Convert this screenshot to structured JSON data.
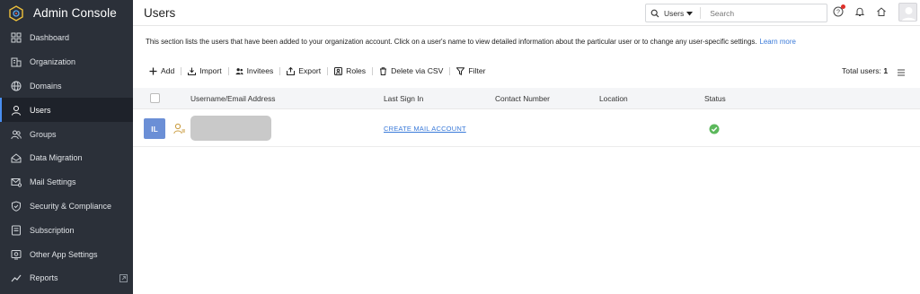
{
  "sidebar": {
    "title": "Admin Console",
    "items": [
      {
        "label": "Dashboard",
        "icon": "dashboard-icon"
      },
      {
        "label": "Organization",
        "icon": "organization-icon"
      },
      {
        "label": "Domains",
        "icon": "globe-icon"
      },
      {
        "label": "Users",
        "icon": "user-icon",
        "active": true
      },
      {
        "label": "Groups",
        "icon": "groups-icon"
      },
      {
        "label": "Data Migration",
        "icon": "migration-icon"
      },
      {
        "label": "Mail Settings",
        "icon": "mail-settings-icon"
      },
      {
        "label": "Security & Compliance",
        "icon": "shield-icon"
      },
      {
        "label": "Subscription",
        "icon": "subscription-icon"
      },
      {
        "label": "Other App Settings",
        "icon": "app-settings-icon"
      },
      {
        "label": "Reports",
        "icon": "reports-icon"
      }
    ]
  },
  "header": {
    "title": "Users",
    "search_scope": "Users",
    "search_placeholder": "Search"
  },
  "description": {
    "text": "This section lists the users that have been added to your organization account. Click on a user's name to view detailed information about the particular user or to change any user-specific settings.",
    "link": "Learn more"
  },
  "toolbar": {
    "add": "Add",
    "import": "Import",
    "invitees": "Invitees",
    "export": "Export",
    "roles": "Roles",
    "delete_csv": "Delete via CSV",
    "filter": "Filter",
    "total_label": "Total users:",
    "total_value": "1"
  },
  "table": {
    "columns": [
      "Username/Email Address",
      "Last Sign In",
      "Contact Number",
      "Location",
      "Status"
    ],
    "rows": [
      {
        "initials": "IL",
        "last_sign_in": "CREATE MAIL ACCOUNT",
        "contact": "",
        "location": "",
        "status": "active"
      }
    ]
  },
  "colors": {
    "sidebar_bg": "#2b3039",
    "accent": "#3a7ad9",
    "avatar": "#6b8fd6",
    "status_ok": "#5cb85c"
  }
}
